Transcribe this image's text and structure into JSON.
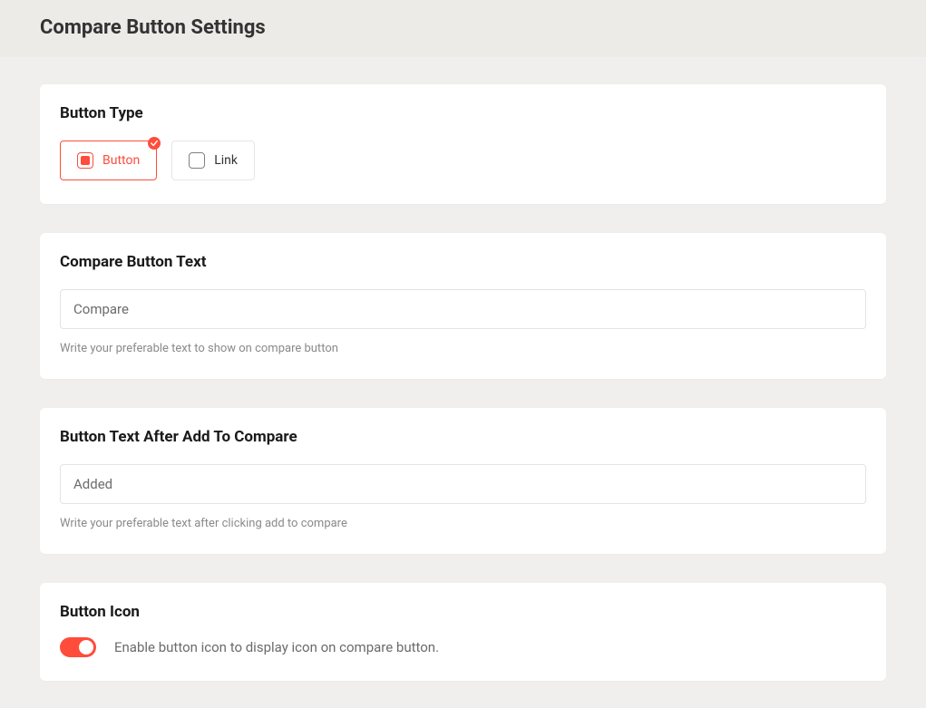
{
  "header": {
    "title": "Compare Button Settings"
  },
  "colors": {
    "accent": "#ff4c3b"
  },
  "button_type": {
    "title": "Button Type",
    "options": [
      {
        "label": "Button",
        "selected": true
      },
      {
        "label": "Link",
        "selected": false
      }
    ]
  },
  "compare_text": {
    "title": "Compare Button Text",
    "value": "Compare",
    "helper": "Write your preferable text to show on compare button"
  },
  "after_add_text": {
    "title": "Button Text After Add To Compare",
    "value": "Added",
    "helper": "Write your preferable text after clicking add to compare"
  },
  "button_icon": {
    "title": "Button Icon",
    "enabled": true,
    "description": "Enable button icon to display icon on compare button."
  }
}
